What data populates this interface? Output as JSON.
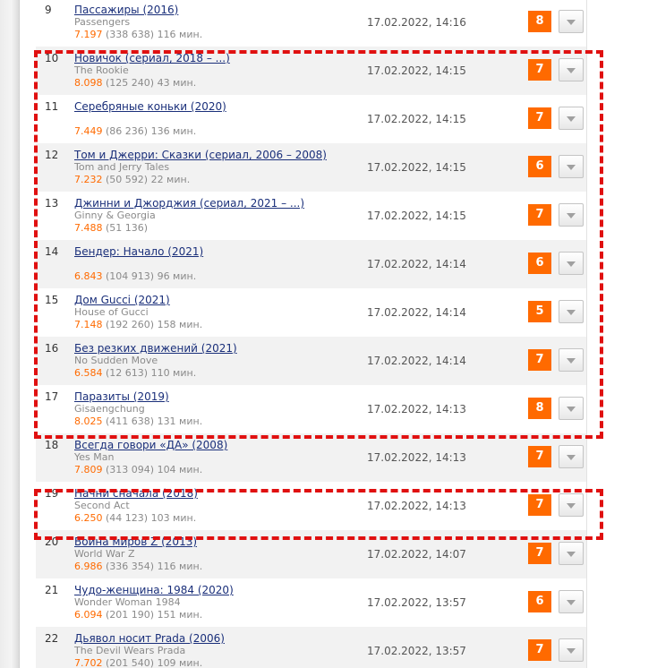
{
  "rows": [
    {
      "num": "9",
      "title": "Пассажиры (2016)",
      "orig": "Passengers",
      "rating": "7.197",
      "votes": " (338 638) 116 мин.",
      "date": "17.02.2022, 14:16",
      "vote": "8"
    },
    {
      "num": "10",
      "title": "Новичок (сериал, 2018 – ...)",
      "orig": "The Rookie",
      "rating": "8.098",
      "votes": " (125 240) 43 мин.",
      "date": "17.02.2022, 14:15",
      "vote": "7"
    },
    {
      "num": "11",
      "title": "Серебряные коньки (2020)",
      "orig": "",
      "rating": "7.449",
      "votes": " (86 236) 136 мин.",
      "date": "17.02.2022, 14:15",
      "vote": "7"
    },
    {
      "num": "12",
      "title": "Том и Джерри: Сказки (сериал, 2006 – 2008)",
      "orig": "Tom and Jerry Tales",
      "rating": "7.232",
      "votes": " (50 592) 22 мин.",
      "date": "17.02.2022, 14:15",
      "vote": "6"
    },
    {
      "num": "13",
      "title": "Джинни и Джорджия (сериал, 2021 – ...)",
      "orig": "Ginny & Georgia",
      "rating": "7.488",
      "votes": " (51 136)",
      "date": "17.02.2022, 14:15",
      "vote": "7"
    },
    {
      "num": "14",
      "title": "Бендер: Начало (2021)",
      "orig": "",
      "rating": "6.843",
      "votes": " (104 913) 96 мин.",
      "date": "17.02.2022, 14:14",
      "vote": "6"
    },
    {
      "num": "15",
      "title": "Дом Gucci (2021)",
      "orig": "House of Gucci",
      "rating": "7.148",
      "votes": " (192 260) 158 мин.",
      "date": "17.02.2022, 14:14",
      "vote": "5"
    },
    {
      "num": "16",
      "title": "Без резких движений (2021)",
      "orig": "No Sudden Move",
      "rating": "6.584",
      "votes": " (12 613) 110 мин.",
      "date": "17.02.2022, 14:14",
      "vote": "7"
    },
    {
      "num": "17",
      "title": "Паразиты (2019)",
      "orig": "Gisaengchung",
      "rating": "8.025",
      "votes": " (411 638) 131 мин.",
      "date": "17.02.2022, 14:13",
      "vote": "8"
    },
    {
      "num": "18",
      "title": "Всегда говори «ДА» (2008)",
      "orig": "Yes Man",
      "rating": "7.809",
      "votes": " (313 094) 104 мин.",
      "date": "17.02.2022, 14:13",
      "vote": "7"
    },
    {
      "num": "19",
      "title": "Начни сначала (2018)",
      "orig": "Second Act",
      "rating": "6.250",
      "votes": " (44 123) 103 мин.",
      "date": "17.02.2022, 14:13",
      "vote": "7"
    },
    {
      "num": "20",
      "title": "Война миров Z (2013)",
      "orig": "World War Z",
      "rating": "6.986",
      "votes": " (336 354) 116 мин.",
      "date": "17.02.2022, 14:07",
      "vote": "7"
    },
    {
      "num": "21",
      "title": "Чудо-женщина: 1984 (2020)",
      "orig": "Wonder Woman 1984",
      "rating": "6.094",
      "votes": " (201 190) 151 мин.",
      "date": "17.02.2022, 13:57",
      "vote": "6"
    },
    {
      "num": "22",
      "title": "Дьявол носит Prada (2006)",
      "orig": "The Devil Wears Prada",
      "rating": "7.702",
      "votes": " (201 540) 109 мин.",
      "date": "17.02.2022, 13:57",
      "vote": "7"
    }
  ],
  "colors": {
    "accent": "#ff6a00",
    "link": "#1a2f7a",
    "selection": "#e01010"
  },
  "icons": {
    "dropdown": "chevron-down-icon"
  }
}
